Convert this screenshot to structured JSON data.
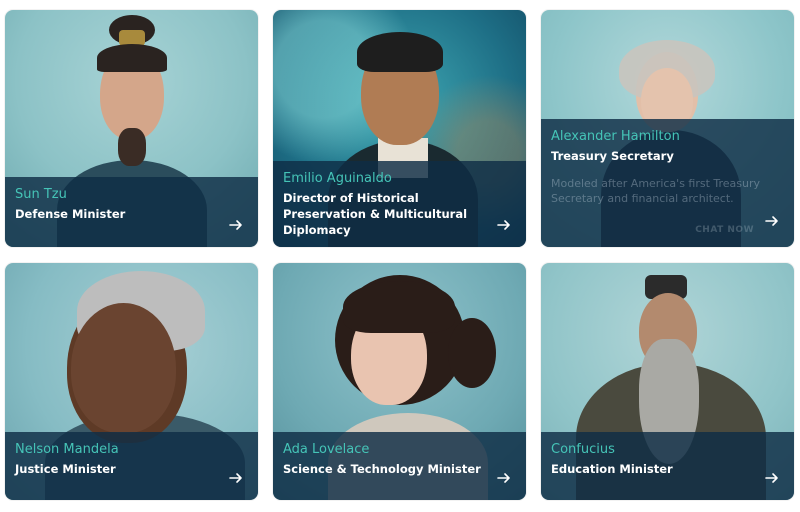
{
  "cards": [
    {
      "name": "Sun Tzu",
      "role": "Defense Minister"
    },
    {
      "name": "Emilio Aguinaldo",
      "role": "Director of Historical Preservation & Multicultural Diplomacy"
    },
    {
      "name": "Alexander Hamilton",
      "role": "Treasury Secretary",
      "description": "Modeled after America's first Treasury Secretary and financial architect.",
      "chat_label": "CHAT NOW"
    },
    {
      "name": "Nelson Mandela",
      "role": "Justice Minister"
    },
    {
      "name": "Ada Lovelace",
      "role": "Science & Technology Minister"
    },
    {
      "name": "Confucius",
      "role": "Education Minister"
    }
  ],
  "colors": {
    "accent": "#45c4b7",
    "panel": "#0f2d46"
  },
  "icons": {
    "open": "arrow-right-icon"
  }
}
